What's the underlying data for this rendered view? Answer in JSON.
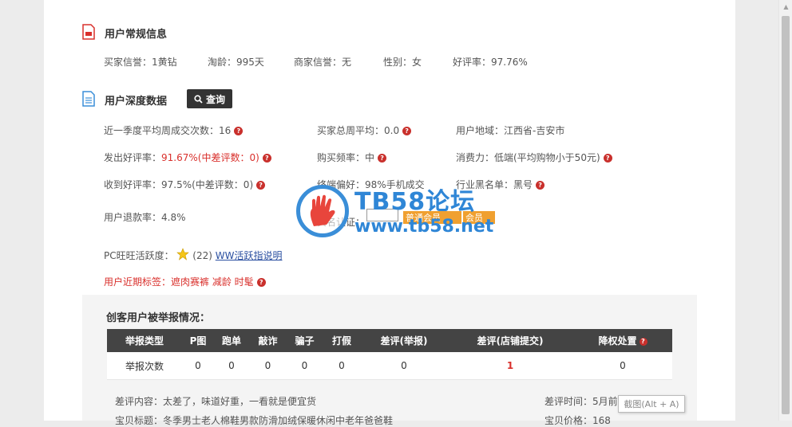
{
  "sections": {
    "general_title": "用户常规信息",
    "deep_title": "用户深度数据",
    "query_label": "查询"
  },
  "general": [
    {
      "label": "买家信誉：",
      "value": "1黄钻"
    },
    {
      "label": "淘龄：",
      "value": "995天"
    },
    {
      "label": "商家信誉：",
      "value": "无"
    },
    {
      "label": "性别：",
      "value": "女"
    },
    {
      "label": "好评率：",
      "value": "97.76%"
    }
  ],
  "deep": {
    "r1c1": "近一季度平均周成交次数：16",
    "r1c2": "买家总周平均：0.0",
    "r1c3": "用户地域：江西省-吉安市",
    "r2c1_label": "发出好评率：",
    "r2c1_value": "91.67%(中差评数：0)",
    "r2c2": "购买频率：中",
    "r2c3": "消费力：低端(平均购物小于50元)",
    "r3c1": "收到好评率：97.5%(中差评数：0)",
    "r3c2": "终端偏好：98%手机成交",
    "r3c3": "行业黑名单：黑号",
    "r4c1": "用户退款率：4.8%",
    "r4c2": "实名认证：",
    "pc_label": "PC旺旺活跃度：",
    "pc_value": "(22)",
    "pc_link": "WW活跃指说明",
    "tags": "用户近期标签：遮肉赛裤 减龄 时髦"
  },
  "badges": {
    "member": "普通会员",
    "other": "会员"
  },
  "watermark": {
    "line1": "TB58论坛",
    "line2": "www.tb58.net"
  },
  "report": {
    "title": "创客用户被举报情况：",
    "headers": [
      "举报类型",
      "P图",
      "跑单",
      "敲诈",
      "骗子",
      "打假",
      "差评(举报)",
      "差评(店铺提交)",
      "降权处置"
    ],
    "row": [
      "举报次数",
      "0",
      "0",
      "0",
      "0",
      "0",
      "0",
      "1",
      "0"
    ],
    "review_label": "差评内容：太差了，味道好重，一看就是便宜货",
    "review_time": "差评时间：5月前",
    "product_title": "宝贝标题：冬季男士老人棉鞋男款防滑加绒保暖休闲中老年爸爸鞋",
    "product_price": "宝贝价格：168"
  },
  "tooltip": "截图(Alt + A)",
  "colors": {
    "accent_red": "#d9302c",
    "header_dark": "#444444",
    "watermark_blue": "#2f86d6",
    "badge_orange": "#f0a030"
  }
}
